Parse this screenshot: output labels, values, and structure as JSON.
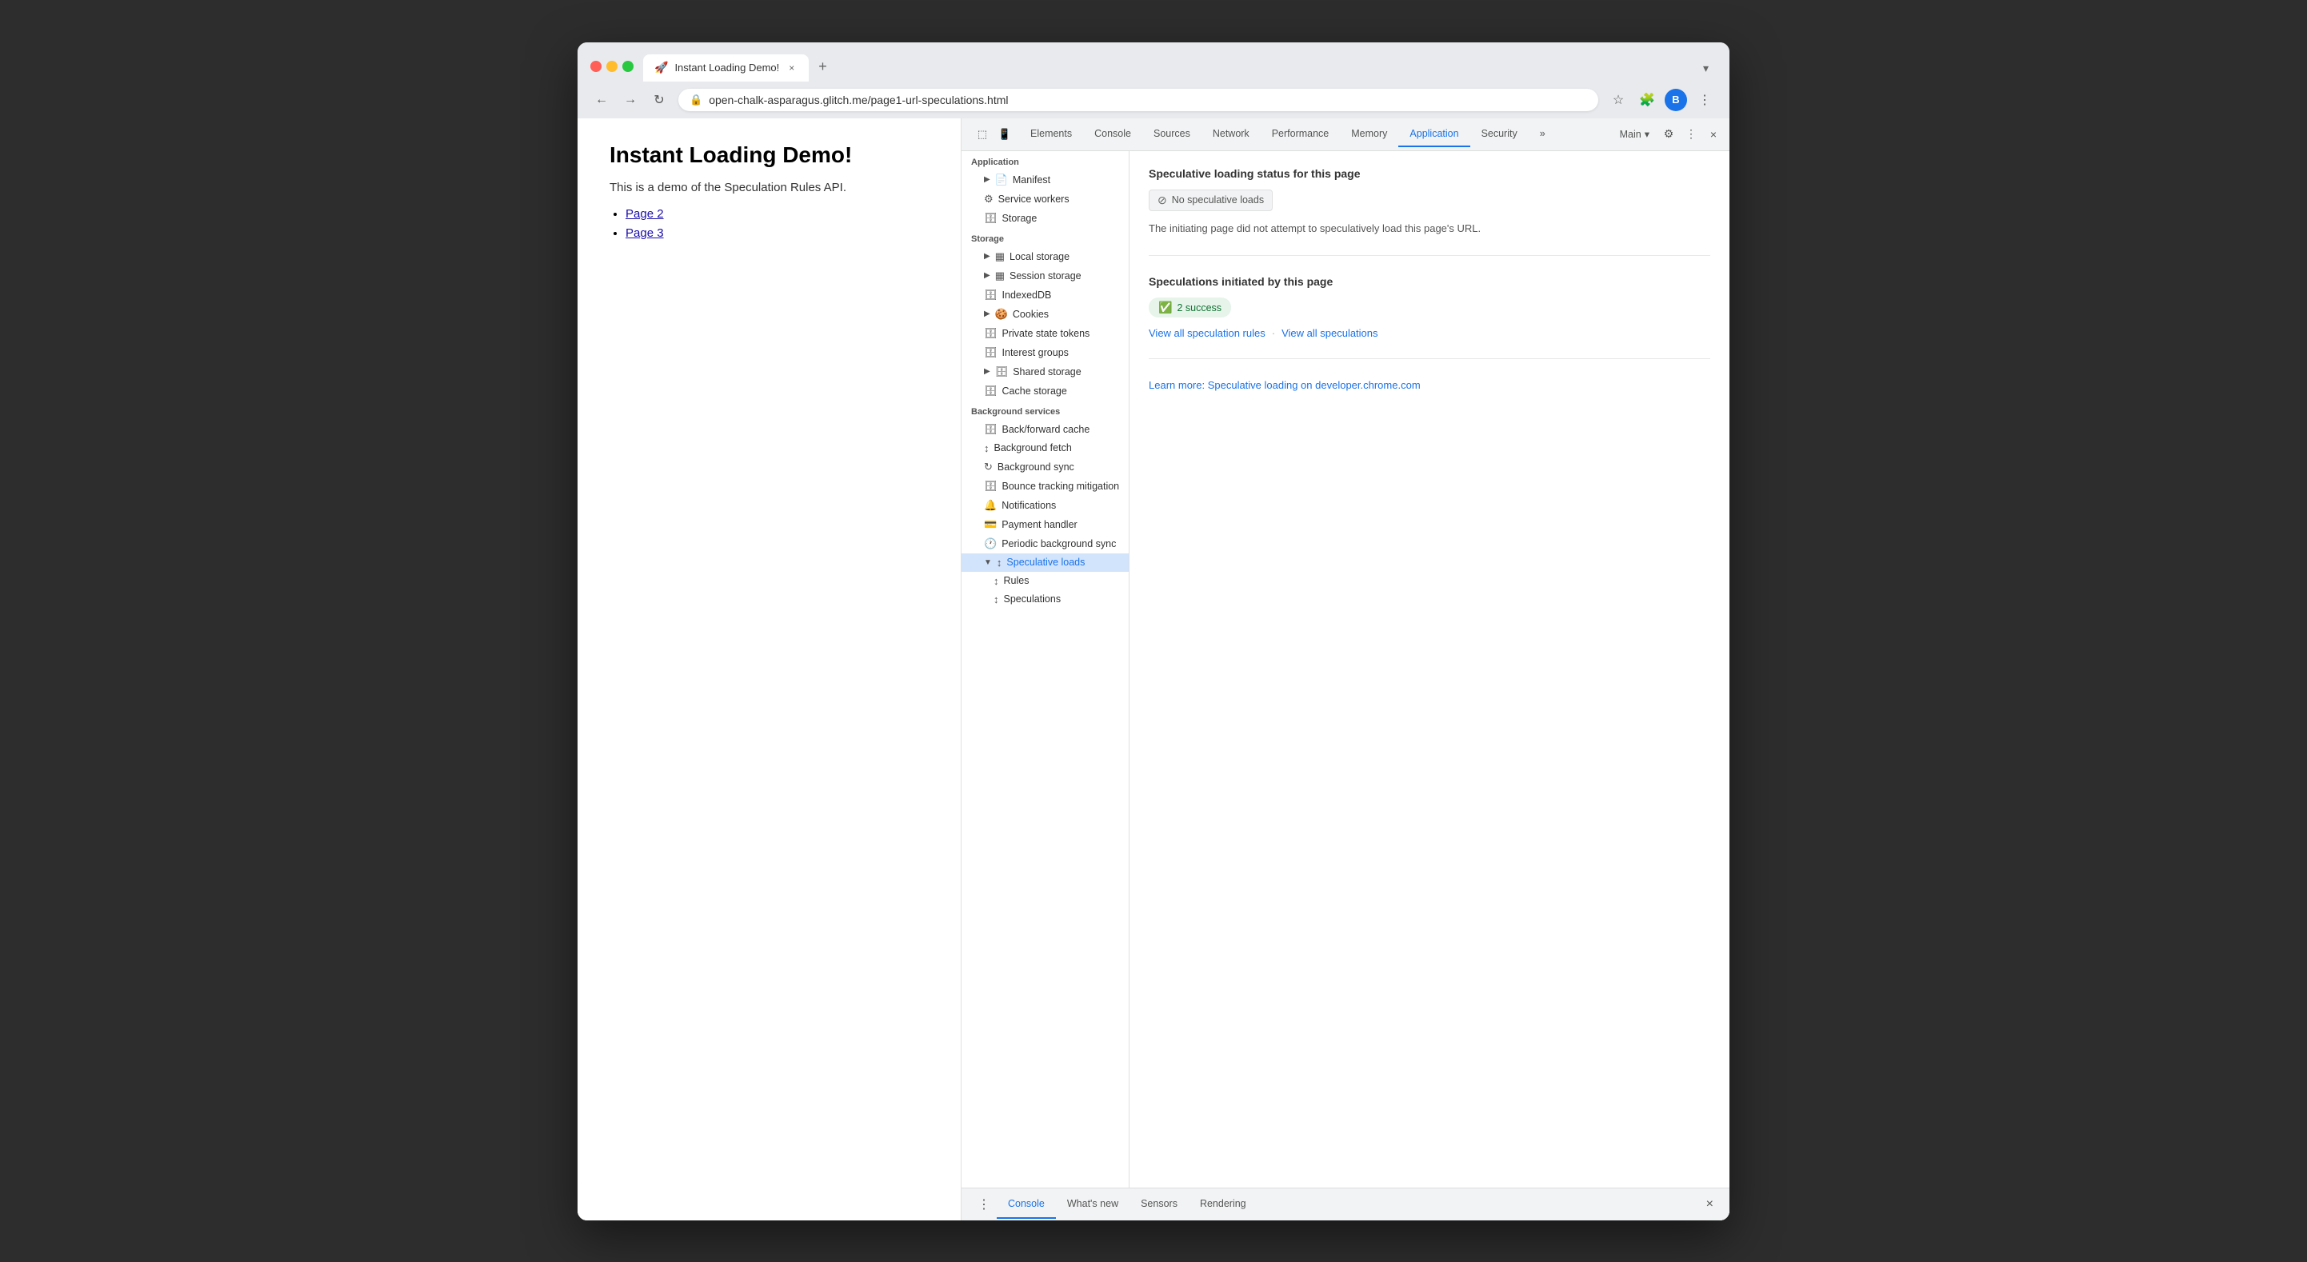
{
  "browser": {
    "tab_title": "Instant Loading Demo!",
    "tab_close": "×",
    "tab_add": "+",
    "tab_dropdown": "▾",
    "nav_back": "←",
    "nav_forward": "→",
    "nav_refresh": "↻",
    "url_icon": "🔒",
    "url": "open-chalk-asparagus.glitch.me/page1-url-speculations.html",
    "toolbar_bookmark": "☆",
    "toolbar_extensions": "🧩",
    "toolbar_profile": "👤",
    "toolbar_menu": "⋮",
    "avatar_letter": "B"
  },
  "webpage": {
    "heading": "Instant Loading Demo!",
    "description": "This is a demo of the Speculation Rules API.",
    "links": [
      {
        "text": "Page 2",
        "href": "#"
      },
      {
        "text": "Page 3",
        "href": "#"
      }
    ]
  },
  "devtools": {
    "tabs": [
      {
        "label": "Elements",
        "active": false
      },
      {
        "label": "Console",
        "active": false
      },
      {
        "label": "Sources",
        "active": false
      },
      {
        "label": "Network",
        "active": false
      },
      {
        "label": "Performance",
        "active": false
      },
      {
        "label": "Memory",
        "active": false
      },
      {
        "label": "Application",
        "active": true
      },
      {
        "label": "Security",
        "active": false
      },
      {
        "label": "»",
        "active": false
      }
    ],
    "end_context": "Main",
    "end_settings_icon": "⚙",
    "end_more_icon": "⋮",
    "end_close": "×",
    "sidebar": {
      "section_application": "Application",
      "items_application": [
        {
          "label": "Manifest",
          "icon": "📄",
          "indent": 1,
          "expandable": true
        },
        {
          "label": "Service workers",
          "icon": "⚙",
          "indent": 1,
          "expandable": false
        },
        {
          "label": "Storage",
          "icon": "🗄",
          "indent": 1,
          "expandable": false
        }
      ],
      "section_storage": "Storage",
      "items_storage": [
        {
          "label": "Local storage",
          "icon": "▦",
          "indent": 1,
          "expandable": true
        },
        {
          "label": "Session storage",
          "icon": "▦",
          "indent": 1,
          "expandable": true
        },
        {
          "label": "IndexedDB",
          "icon": "🗄",
          "indent": 1,
          "expandable": false
        },
        {
          "label": "Cookies",
          "icon": "🍪",
          "indent": 1,
          "expandable": true
        },
        {
          "label": "Private state tokens",
          "icon": "🗄",
          "indent": 1,
          "expandable": false
        },
        {
          "label": "Interest groups",
          "icon": "🗄",
          "indent": 1,
          "expandable": false
        },
        {
          "label": "Shared storage",
          "icon": "🗄",
          "indent": 1,
          "expandable": true
        },
        {
          "label": "Cache storage",
          "icon": "🗄",
          "indent": 1,
          "expandable": false
        }
      ],
      "section_background": "Background services",
      "items_background": [
        {
          "label": "Back/forward cache",
          "icon": "🗄",
          "indent": 1,
          "expandable": false
        },
        {
          "label": "Background fetch",
          "icon": "↕",
          "indent": 1,
          "expandable": false
        },
        {
          "label": "Background sync",
          "icon": "↻",
          "indent": 1,
          "expandable": false
        },
        {
          "label": "Bounce tracking mitigation",
          "icon": "🗄",
          "indent": 1,
          "expandable": false
        },
        {
          "label": "Notifications",
          "icon": "🔔",
          "indent": 1,
          "expandable": false
        },
        {
          "label": "Payment handler",
          "icon": "💳",
          "indent": 1,
          "expandable": false
        },
        {
          "label": "Periodic background sync",
          "icon": "🕐",
          "indent": 1,
          "expandable": false
        },
        {
          "label": "Speculative loads",
          "icon": "↕",
          "indent": 1,
          "expandable": true,
          "expanded": true,
          "active": true
        },
        {
          "label": "Rules",
          "icon": "↕",
          "indent": 2,
          "expandable": false
        },
        {
          "label": "Speculations",
          "icon": "↕",
          "indent": 2,
          "expandable": false
        }
      ]
    },
    "content": {
      "loading_status_title": "Speculative loading status for this page",
      "no_loads_badge": "No speculative loads",
      "no_loads_description": "The initiating page did not attempt to speculatively load this page's URL.",
      "speculations_title": "Speculations initiated by this page",
      "success_count": "2 success",
      "view_rules_link": "View all speculation rules",
      "view_speculations_link": "View all speculations",
      "learn_more_link": "Learn more: Speculative loading on developer.chrome.com"
    },
    "bottom_tabs": [
      {
        "label": "Console",
        "active": true
      },
      {
        "label": "What's new",
        "active": false
      },
      {
        "label": "Sensors",
        "active": false
      },
      {
        "label": "Rendering",
        "active": false
      }
    ]
  }
}
